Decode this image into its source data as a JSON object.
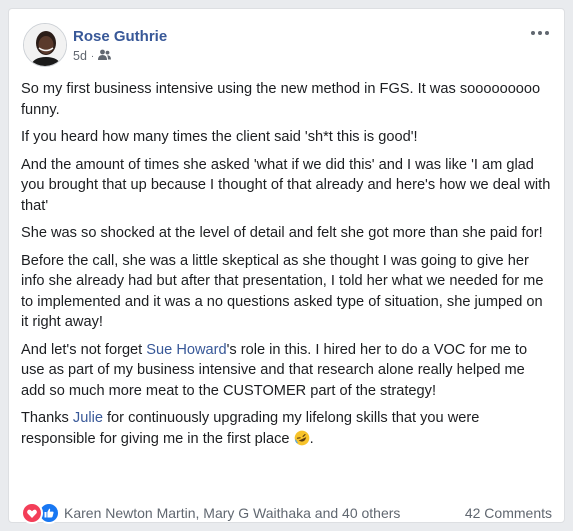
{
  "post": {
    "author": "Rose Guthrie",
    "time": "5d",
    "audience_icon": "friends-icon",
    "paragraphs": {
      "p1": "So my first business intensive using the new method in FGS. It was sooooooooo funny.",
      "p2": "If you heard how many times the client said 'sh*t this is good'!",
      "p3": "And the amount of times she asked 'what if we did this' and I was like 'I am glad you brought that up because I thought of that already and here's how we deal with that'",
      "p4": "She was so shocked at the level of detail and felt she got more than she paid for!",
      "p5": "Before the call, she was a little skeptical as she thought I was going to give her info she already had but after that presentation, I told her what we needed for me to implemented and it was a no questions asked type of situation, she jumped on it right away!",
      "p6_pre": "And let's not forget ",
      "p6_link": "Sue Howard",
      "p6_post": "'s role in this. I hired her to do a VOC for me to use as part of my business intensive and that research alone really helped me add so much more meat to the CUSTOMER part of the strategy!",
      "p7_pre": "Thanks ",
      "p7_link": "Julie",
      "p7_post": " for continuously upgrading my lifelong skills that you were responsible for giving me in the first place ",
      "p7_end": "."
    }
  },
  "footer": {
    "reactions": [
      "love-reaction-icon",
      "like-reaction-icon"
    ],
    "reactors": "Karen Newton Martin, Mary G Waithaka and 40 others",
    "comments": "42 Comments"
  },
  "colors": {
    "link": "#385898",
    "text": "#1c1e21",
    "meta": "#616770",
    "love": "#f33e58",
    "like": "#1877f2"
  }
}
